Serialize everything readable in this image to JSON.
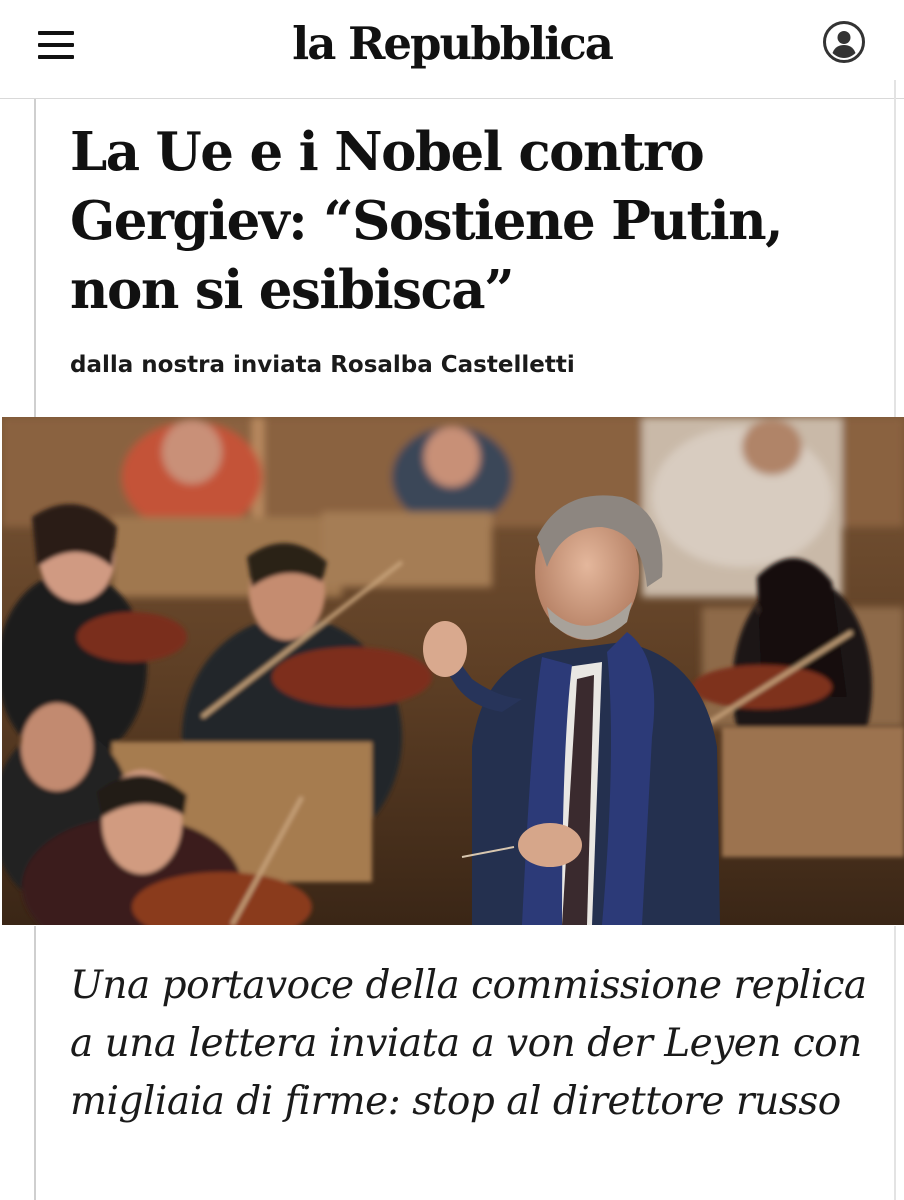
{
  "header": {
    "logo": "la Repubblica",
    "menu_icon": "hamburger-menu-icon",
    "account_icon": "user-account-icon"
  },
  "article": {
    "title": "La Ue e i Nobel contro Gergiev: “Sostiene Putin, non si esibisca”",
    "byline": "dalla nostra inviata Rosalba Castelletti",
    "summary": "Una portavoce della commissione replica a una lettera inviata a von der Leyen con migliaia di firme: stop al direttore russo"
  },
  "colors": {
    "text": "#111111",
    "divider": "#d9d9d9",
    "background": "#ffffff"
  }
}
